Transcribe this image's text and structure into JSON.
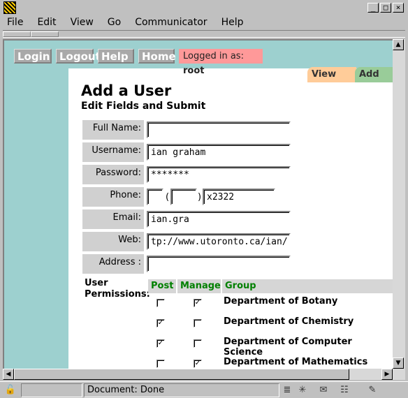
{
  "window": {
    "minimize": "_",
    "maximize": "□",
    "close": "×"
  },
  "menu": [
    "File",
    "Edit",
    "View",
    "Go",
    "Communicator",
    "Help"
  ],
  "nav": {
    "login": "Login",
    "logout": "Logout",
    "help": "Help",
    "home": "Home",
    "logged_prefix": "Logged in as:",
    "logged_user": "root"
  },
  "tabs": {
    "view": "View",
    "add": "Add"
  },
  "page": {
    "title": "Add a User",
    "subtitle": "Edit Fields and Submit"
  },
  "form": {
    "fullname": {
      "label": "Full Name:",
      "value": ""
    },
    "username": {
      "label": "Username:",
      "value": "ian graham"
    },
    "password": {
      "label": "Password:",
      "value": "*******"
    },
    "phone": {
      "label": "Phone:",
      "area": "",
      "prefix": "",
      "number": "x2322",
      "open_paren": "(",
      "close_paren": ")"
    },
    "email": {
      "label": "Email:",
      "value": "ian.gra"
    },
    "web": {
      "label": "Web:",
      "value": "tp://www.utoronto.ca/ian/"
    },
    "address": {
      "label": "Address :",
      "value": ""
    }
  },
  "permissions": {
    "label_line1": "User",
    "label_line2": "Permissions:",
    "headers": {
      "post": "Post",
      "manage": "Manage",
      "group": "Group"
    },
    "rows": [
      {
        "group": "Department of Botany",
        "post": false,
        "manage": true
      },
      {
        "group": "Department of Chemistry",
        "post": true,
        "manage": false
      },
      {
        "group": "Department of Computer Science",
        "post": true,
        "manage": false
      },
      {
        "group": "Department of Mathematics",
        "post": false,
        "manage": true
      }
    ]
  },
  "status": {
    "text": "Document: Done"
  }
}
